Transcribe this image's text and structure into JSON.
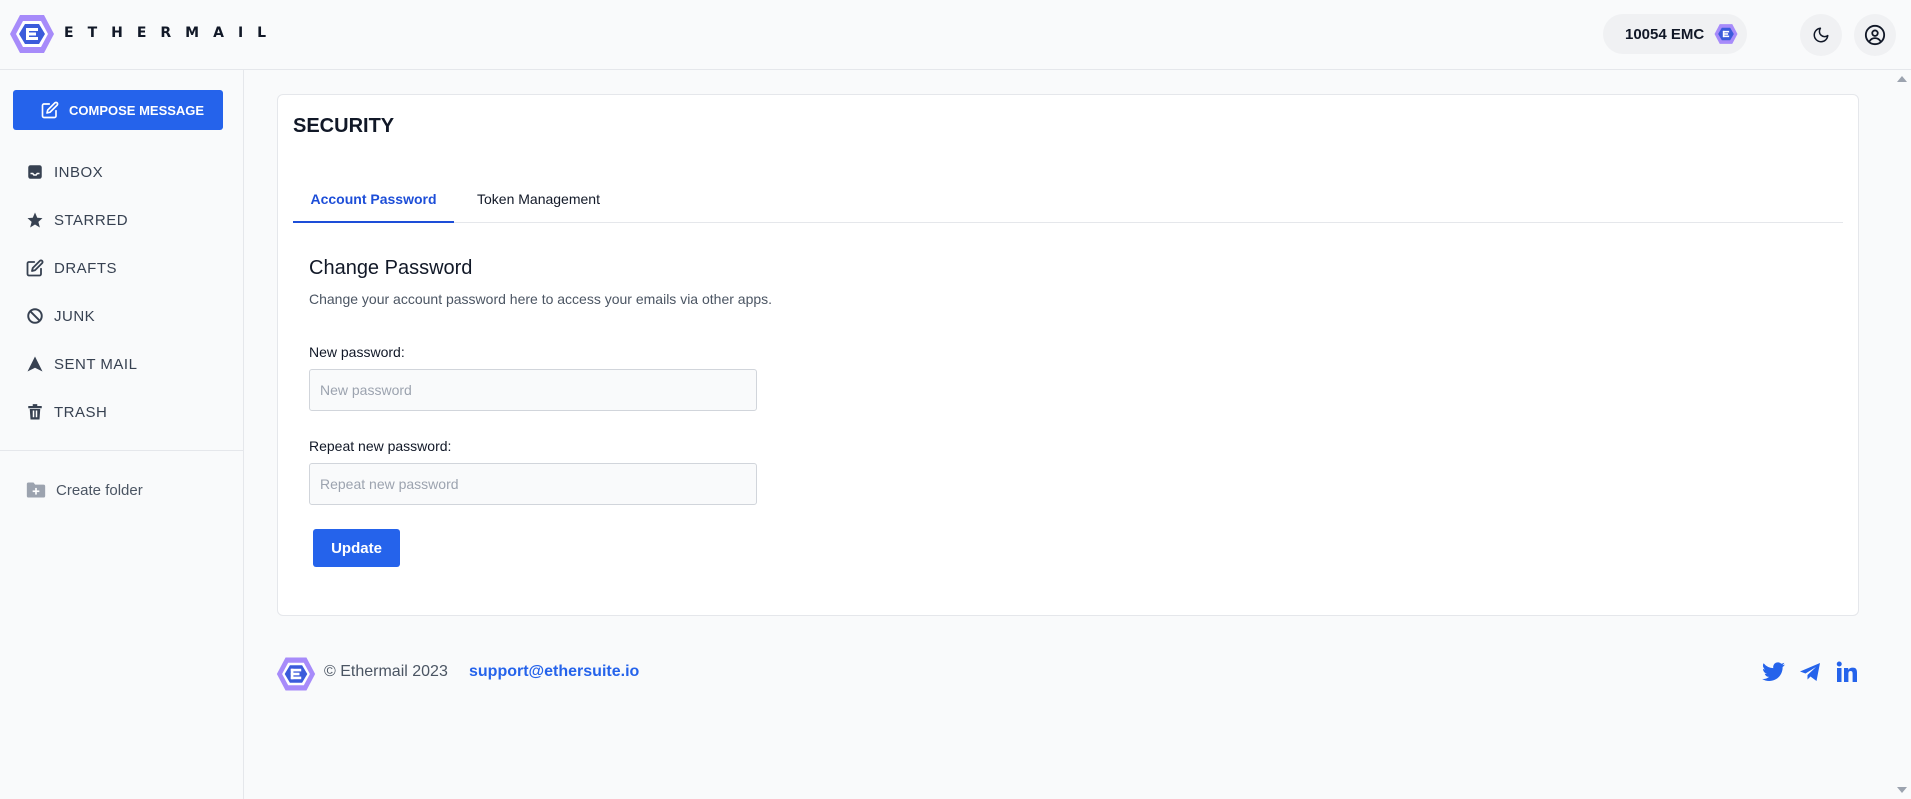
{
  "header": {
    "brand": "ETHERMAIL",
    "balance": "10054 EMC",
    "icons": {
      "theme_toggle": "moon-icon",
      "profile": "user-circle-icon",
      "token": "ethermail-logo-icon"
    }
  },
  "sidebar": {
    "compose_label": "COMPOSE MESSAGE",
    "items": [
      {
        "label": "INBOX",
        "icon": "inbox-icon"
      },
      {
        "label": "STARRED",
        "icon": "star-icon"
      },
      {
        "label": "DRAFTS",
        "icon": "pencil-square-icon"
      },
      {
        "label": "JUNK",
        "icon": "ban-icon"
      },
      {
        "label": "SENT MAIL",
        "icon": "send-icon"
      },
      {
        "label": "TRASH",
        "icon": "trash-icon"
      }
    ],
    "create_folder_label": "Create folder"
  },
  "main": {
    "title": "SECURITY",
    "tabs": [
      {
        "label": "Account Password",
        "active": true
      },
      {
        "label": "Token Management",
        "active": false
      }
    ],
    "section": {
      "title": "Change Password",
      "description": "Change your account password here to access your emails via other apps.",
      "new_password_label": "New password:",
      "new_password_placeholder": "New password",
      "new_password_value": "",
      "repeat_password_label": "Repeat new password:",
      "repeat_password_placeholder": "Repeat new password",
      "repeat_password_value": "",
      "submit_label": "Update"
    }
  },
  "footer": {
    "copyright": "© Ethermail 2023",
    "support_email": "support@ethersuite.io",
    "social_icons": [
      "twitter-icon",
      "telegram-icon",
      "linkedin-icon"
    ]
  },
  "colors": {
    "accent": "#2563eb",
    "logo_purple": "#a78bfa",
    "logo_blue": "#3b5bdb",
    "background": "#f9fafb",
    "border": "#e5e7eb"
  }
}
